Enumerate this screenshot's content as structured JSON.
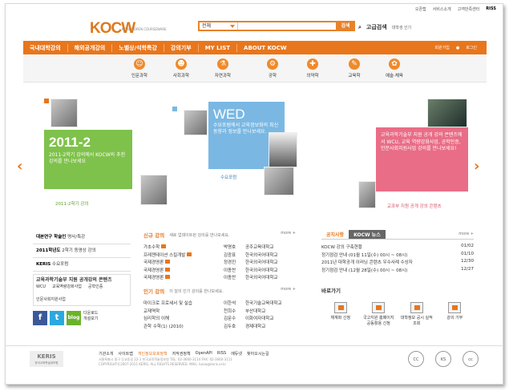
{
  "toplinks": [
    "오픈랩",
    "서비스소개",
    "고객만족센터",
    "RISS"
  ],
  "logo": {
    "text": "KOCW",
    "sub": "KOREA OPEN COURSEWARE"
  },
  "search": {
    "scope": "전체",
    "value": "",
    "button": "검색",
    "advanced": "고급검색",
    "trend": "대학생 인기"
  },
  "nav": {
    "items": [
      "국내대학강의",
      "해외공개강의",
      "노벨상/석학특강",
      "강의기부",
      "MY LIST",
      "ABOUT KOCW"
    ],
    "join": "회원가입",
    "login": "로그인"
  },
  "categories": [
    "인문과학",
    "사회과학",
    "자연과학",
    "공학",
    "의약학",
    "교육학",
    "예술·체육"
  ],
  "categoryIcons": [
    "person-icon",
    "people-icon",
    "flask-icon",
    "gear-icon",
    "cross-icon",
    "pencil-icon",
    "palette-icon"
  ],
  "banner": {
    "green": {
      "year": "2011-2",
      "text": "2011-2학기 강의에서 KOCW의 추천강의를 만나보세요",
      "caption": "2011-2학기 강의"
    },
    "blue": {
      "title": "WED",
      "text": "수요포럼에서 교육정보화의 최신동향과 정보를 만나보세요.",
      "caption": "수요포럼"
    },
    "pink": {
      "text": "교육과학기술부 지원 공개 강의 콘텐츠에서 WCU, 교육 역량강화사업, 공학인증, 인문사회지원사업 강의를 만나보세요!",
      "caption": "교과부 지원 공개 강의 콘텐츠"
    },
    "prev": "‹",
    "next": "›"
  },
  "sidebar": {
    "rows": [
      {
        "main": "대본연구 학술인",
        "sub": "명사/특강"
      },
      {
        "main": "2011학년도",
        "sub": "2학기 동영상 강의"
      },
      {
        "main": "KERIS",
        "sub": "수요포럼"
      }
    ],
    "boxTitle": "교육과학기술부 지원 공개강의 콘텐츠",
    "boxItems": [
      "WCU",
      "교육역량강화사업",
      "공학인증",
      "인문사회지원사업"
    ],
    "socialLabels": [
      "f",
      "t",
      "blog"
    ],
    "socialNote": "다운로드\n개설보기"
  },
  "newCourses": {
    "title": "신규 강의",
    "subtitle": "새로 업데이트된 강의를 만나보세요.",
    "more": "more +",
    "rows": [
      {
        "t": "가초수학",
        "n": "박명호",
        "u": "공주교육대학교"
      },
      {
        "t": "프레젠테이션 스킬개발",
        "n": "김광표",
        "u": "한국외국어대학교"
      },
      {
        "t": "국제경영론",
        "n": "정경진",
        "u": "한국외국어대학교"
      },
      {
        "t": "국제경영론",
        "n": "이종찬",
        "u": "한국외국어대학교"
      },
      {
        "t": "국제경영론",
        "n": "이종찬",
        "u": "한국외국어대학교"
      }
    ]
  },
  "popular": {
    "title": "인기 강의",
    "subtitle": "이 달의 인기 강의를 만나보세요.",
    "more": "more +",
    "rows": [
      {
        "t": "마이크로 프로세서 및 실습",
        "n": "이한석",
        "u": "한국기술교육대학교"
      },
      {
        "t": "교재역학",
        "n": "천희수",
        "u": "부산대학교"
      },
      {
        "t": "심리학의 이해",
        "n": "김문수",
        "u": "이화여자대학교"
      },
      {
        "t": "관학 수학(1) (2010)",
        "n": "김두호",
        "u": "경제대학교"
      }
    ]
  },
  "notice": {
    "tabs": [
      "공지사항",
      "KOCW 뉴스"
    ],
    "more": "more +",
    "rows": [
      {
        "t": "KOCW 강의 구축현황",
        "d": "01/02"
      },
      {
        "t": "정기점검 안내 (01월 11일(수) 00시 ~ 08시)",
        "d": "01/10"
      },
      {
        "t": "2011년 대학공개 이러닝 콘텐츠 우수사례 수상자",
        "d": "12/30"
      },
      {
        "t": "정기점검 안내 (12월 28일(수) 00시 ~ 08시)",
        "d": "12/27"
      }
    ]
  },
  "shortcuts": {
    "title": "바로가기",
    "items": [
      "체계화 신청",
      "국고지원 홈페이지 공동활용 신청",
      "대학정보 공시 실적조회",
      "강의 기부"
    ]
  },
  "footer": {
    "logo": "KERIS",
    "logoSub": "한국교육학술정보원",
    "links": [
      "기관소개",
      "사이트맵",
      "개인정보보호정책",
      "저작권정책",
      "OpenAPI",
      "RISS",
      "에듀넷",
      "찾아오시는길"
    ],
    "address": "서울특별시 중구 무교동길 22-1 한국교육학술정보원 TEL: 02-3660-3114 FAX: 02-3660-3111",
    "copyright": "COPYRIGHT©2007-2011 KERIS. ALL RIGHTS RESERVED. MAIL: kocw@keris.or.kr",
    "badges": [
      "CC",
      "KS",
      "cc"
    ]
  }
}
